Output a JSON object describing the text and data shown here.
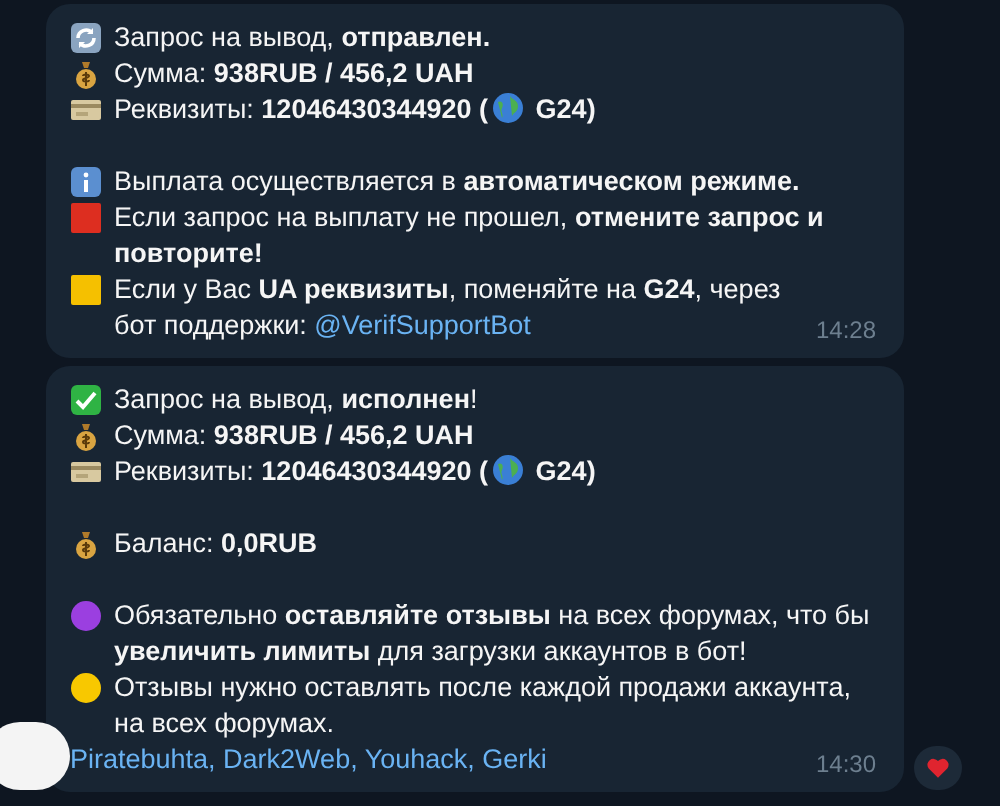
{
  "messages": [
    {
      "lines": [
        {
          "kind": "refresh",
          "segments": [
            {
              "kind": "text",
              "text": "Запрос на вывод, **отправлен.**"
            }
          ]
        },
        {
          "kind": "money-bag",
          "segments": [
            {
              "kind": "text",
              "text": "Сумма: **938RUB  / 456,2 UAH**"
            }
          ]
        },
        {
          "kind": "card",
          "segments": [
            {
              "kind": "text",
              "text": "Реквизиты: **12046430344920 (**"
            },
            {
              "kind": "globe"
            },
            {
              "kind": "text",
              "text": " **G24)**"
            }
          ]
        },
        {
          "kind": "blank"
        },
        {
          "kind": "info",
          "segments": [
            {
              "kind": "text",
              "text": "Выплата осуществляется в **автоматическом режиме.**"
            }
          ]
        },
        {
          "kind": "red-square",
          "segments": [
            {
              "kind": "text",
              "text": "Если запрос на выплату не прошел, **отмените запрос и повторите!**"
            }
          ]
        },
        {
          "kind": "yellow-square",
          "segments": [
            {
              "kind": "text",
              "text": "Если у Вас **UA реквизиты**, поменяйте на **G24**, через бот поддержки: "
            },
            {
              "kind": "link",
              "text": "@VerifSupportBot"
            }
          ]
        }
      ],
      "time": "14:28"
    },
    {
      "lines": [
        {
          "kind": "check",
          "segments": [
            {
              "kind": "text",
              "text": "Запрос на вывод, **исполнен**!"
            }
          ]
        },
        {
          "kind": "money-bag",
          "segments": [
            {
              "kind": "text",
              "text": "Сумма: **938RUB  / 456,2 UAH**"
            }
          ]
        },
        {
          "kind": "card",
          "segments": [
            {
              "kind": "text",
              "text": "Реквизиты: **12046430344920 (**"
            },
            {
              "kind": "globe"
            },
            {
              "kind": "text",
              "text": " **G24)**"
            }
          ]
        },
        {
          "kind": "blank"
        },
        {
          "kind": "money-bag",
          "segments": [
            {
              "kind": "text",
              "text": "Баланс: **0,0RUB**"
            }
          ]
        },
        {
          "kind": "blank"
        },
        {
          "kind": "purple-circle",
          "segments": [
            {
              "kind": "text",
              "text": "Обязательно **оставляйте отзывы** на всех форумах, что бы **увеличить лимиты** для загрузки аккаунтов в бот!"
            }
          ]
        },
        {
          "kind": "yellow-circle",
          "segments": [
            {
              "kind": "text",
              "text": "Отзывы нужно оставлять после каждой продажи аккаунта, на всех форумах."
            }
          ]
        },
        {
          "kind": "plain",
          "segments": [
            {
              "kind": "link",
              "text": "Piratebuhta, Dark2Web, Youhack, Gerki"
            }
          ]
        }
      ],
      "time": "14:30",
      "reacted": true,
      "avatar": true
    }
  ]
}
